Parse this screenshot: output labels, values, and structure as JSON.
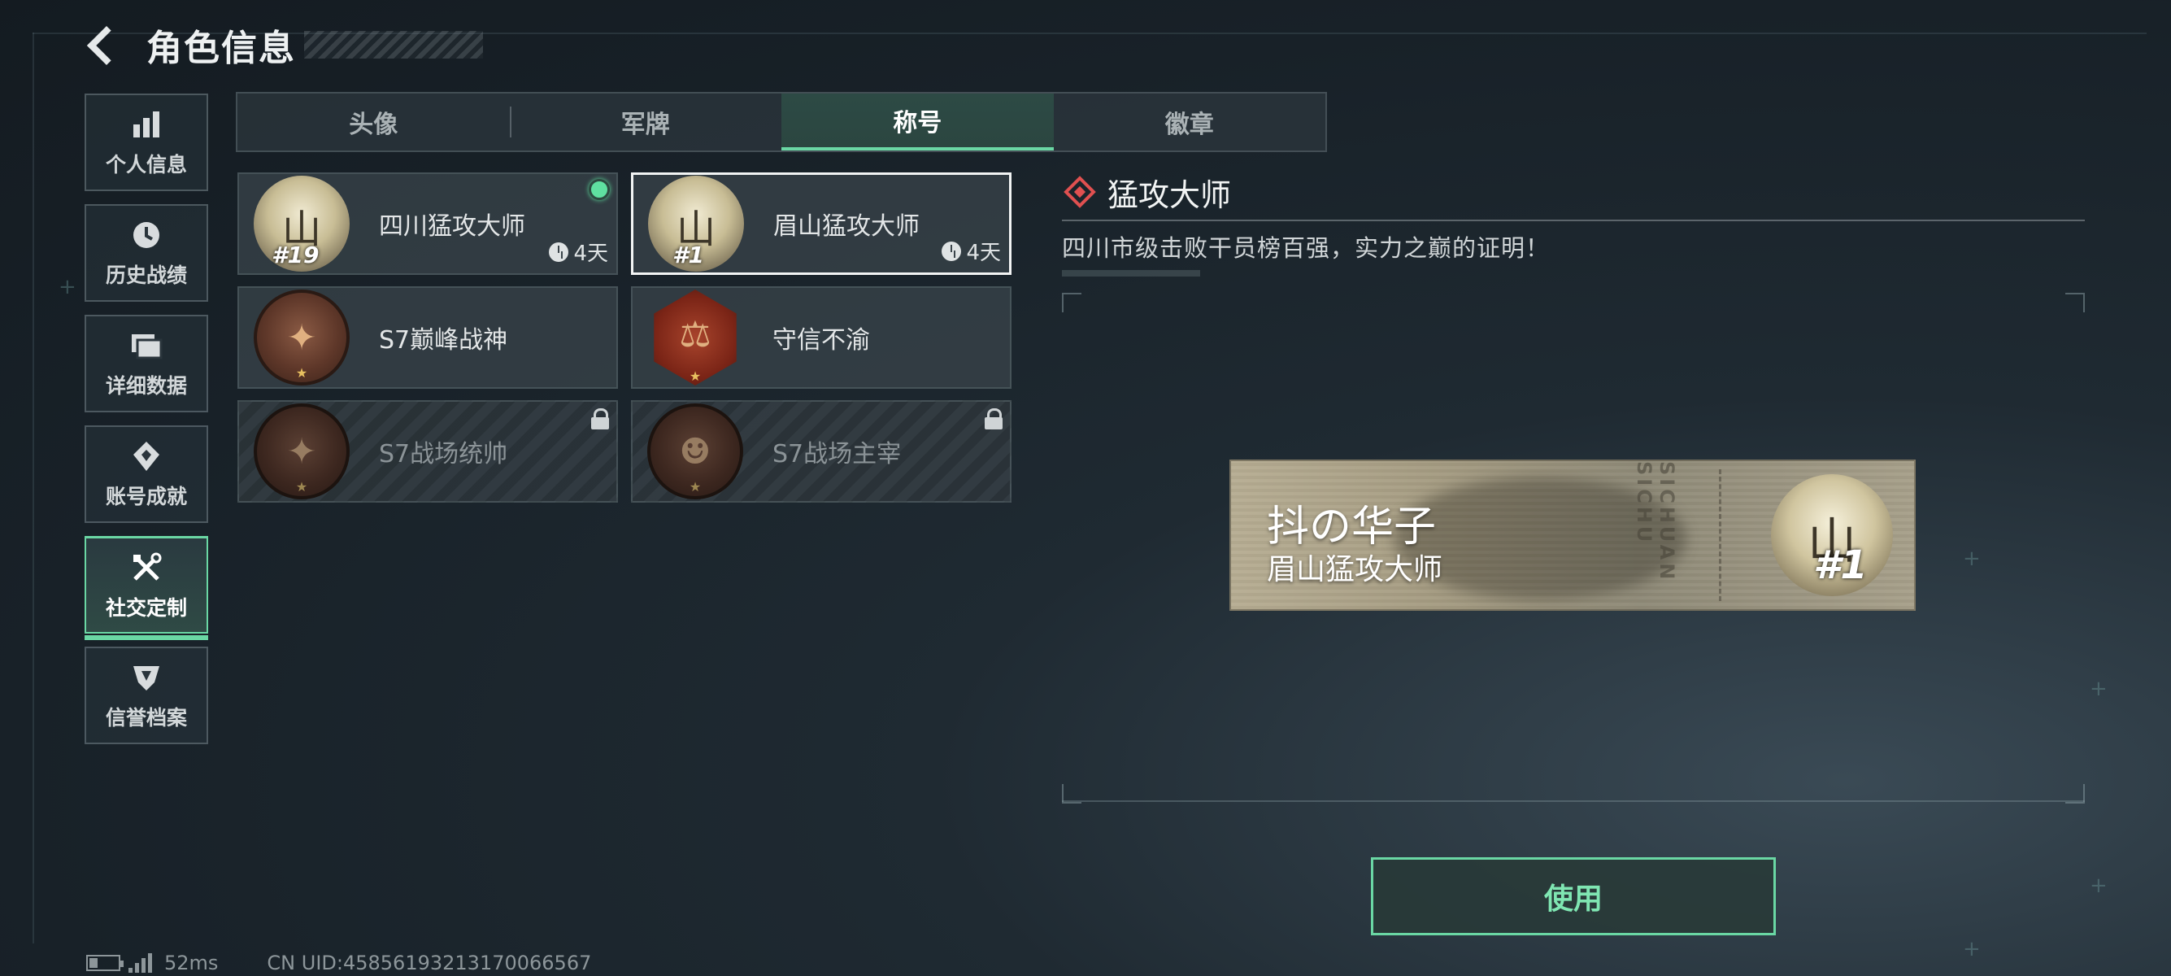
{
  "header": {
    "title": "角色信息"
  },
  "side_nav": [
    {
      "label": "个人信息",
      "icon": "bar-chart-icon"
    },
    {
      "label": "历史战绩",
      "icon": "clock-history-icon"
    },
    {
      "label": "详细数据",
      "icon": "folder-icon"
    },
    {
      "label": "账号成就",
      "icon": "achievement-icon"
    },
    {
      "label": "社交定制",
      "icon": "tools-icon",
      "active": true
    },
    {
      "label": "信誉档案",
      "icon": "shield-icon"
    }
  ],
  "tabs": [
    {
      "label": "头像"
    },
    {
      "label": "军牌"
    },
    {
      "label": "称号",
      "active": true
    },
    {
      "label": "徽章"
    }
  ],
  "titles": [
    {
      "name": "四川猛攻大师",
      "rank": "#19",
      "time": "4天",
      "equipped": true,
      "selected": false,
      "locked": false
    },
    {
      "name": "眉山猛攻大师",
      "rank": "#1",
      "time": "4天",
      "equipped": false,
      "selected": true,
      "locked": false
    },
    {
      "name": "S7巅峰战神",
      "rank": "",
      "time": "",
      "equipped": false,
      "selected": false,
      "locked": false
    },
    {
      "name": "守信不渝",
      "rank": "",
      "time": "",
      "equipped": false,
      "selected": false,
      "locked": false
    },
    {
      "name": "S7战场统帅",
      "rank": "",
      "time": "",
      "equipped": false,
      "selected": false,
      "locked": true
    },
    {
      "name": "S7战场主宰",
      "rank": "",
      "time": "",
      "equipped": false,
      "selected": false,
      "locked": true
    }
  ],
  "detail": {
    "title": "猛攻大师",
    "description": "四川市级击败干员榜百强，实力之巅的证明！"
  },
  "nameplate": {
    "player_name": "抖の华子",
    "title": "眉山猛攻大师",
    "vertical_text": "SICHUAN SICHU",
    "rank": "#1"
  },
  "use_button": "使用",
  "footer": {
    "ping": "52ms",
    "uid": "CN UID:4585619321317006656​7"
  },
  "colors": {
    "accent": "#6ad7a4",
    "marker": "#e05050"
  }
}
